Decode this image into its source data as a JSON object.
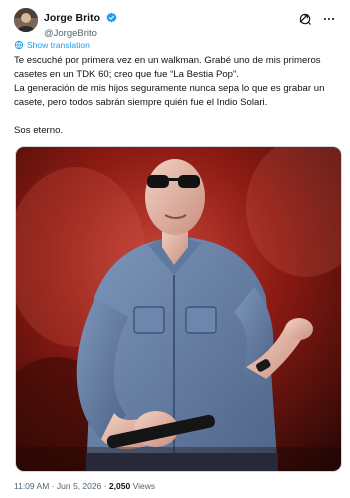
{
  "author": {
    "display_name": "Jorge Brito",
    "handle": "@JorgeBrito",
    "verified": true,
    "avatar_icon": "avatar-photo"
  },
  "header_actions": [
    {
      "icon": "grok-icon"
    },
    {
      "icon": "more-options-icon"
    }
  ],
  "translate_label": "Show translation",
  "tweet": {
    "line1": "Te escuché por primera vez en un walkman. Grabé uno de mis primeros",
    "line2": "casetes en un TDK 60; creo que fue “La Bestia Pop”.",
    "line3": "La generación de mis hijos seguramente nunca sepa lo que es grabar un",
    "line4": "casete, pero todos sabrán siempre quién fue el Indio Solari.",
    "line5": "Sos eterno."
  },
  "media": {
    "kind": "photo",
    "subject": "singer-on-stage-photo"
  },
  "meta": {
    "time": "11:09 AM",
    "sep1": "·",
    "date": "Jun 5, 2026",
    "sep2": "·",
    "views_count": "2,050",
    "views_label": "Views"
  },
  "colors": {
    "link": "#1d9bf0",
    "text": "#0f1419",
    "secondary": "#536471",
    "stage_red": "#8b1a12"
  }
}
